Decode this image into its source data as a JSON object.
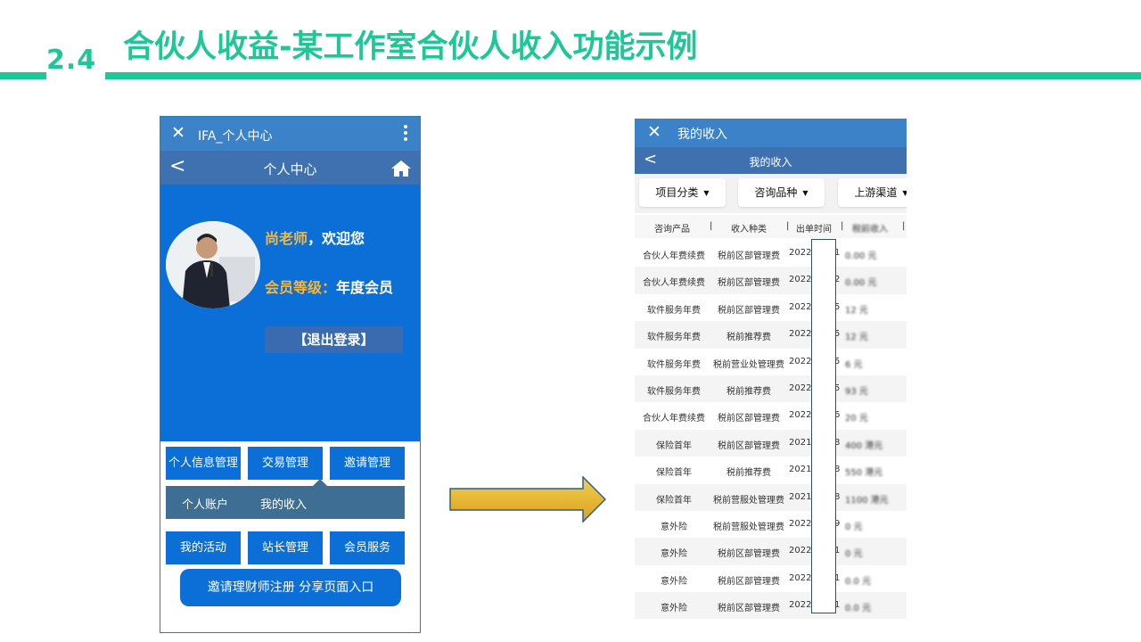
{
  "slide": {
    "section_number": "2.4",
    "title": "合伙人收益-某工作室合伙人收入功能示例",
    "accent_color": "#1ec896"
  },
  "phone_profile": {
    "app_bar": {
      "close_icon": "close-icon",
      "title": "IFA_个人中心",
      "menu_icon": "more-vertical-icon"
    },
    "nav_bar": {
      "back_icon": "chevron-left-icon",
      "title": "个人中心",
      "home_icon": "home-icon"
    },
    "hero": {
      "avatar_icon": "avatar",
      "name": "尚老师",
      "greeting": "，欢迎您",
      "level_label": "会员等级：",
      "level_value": "年度会员",
      "logout_label": "【退出登录】"
    },
    "menu_row1": [
      "个人信息管理",
      "交易管理",
      "邀请管理"
    ],
    "submenu": [
      "个人账户",
      "我的收入"
    ],
    "menu_row2": [
      "我的活动",
      "站长管理",
      "会员服务"
    ],
    "invite_button": "邀请理财师注册 分享页面入口",
    "colors": {
      "header": "#3b82c9",
      "nav": "#3f71b0",
      "primary": "#0b6fd7",
      "gold": "#f6b73c",
      "submenu": "#3e6e94"
    }
  },
  "phone_income": {
    "app_bar": {
      "close_icon": "close-icon",
      "title": "我的收入"
    },
    "nav_bar": {
      "back_icon": "chevron-left-icon",
      "title": "我的收入"
    },
    "filters": [
      "项目分类",
      "咨询品种",
      "上游渠道"
    ],
    "columns": [
      "咨询产品",
      "收入种类",
      "出单时间",
      "税前收入"
    ],
    "rows": [
      {
        "product": "合伙人年费续费",
        "kind": "税前区部管理费",
        "date": "2022",
        "day": "1",
        "amount": "0.00 元"
      },
      {
        "product": "合伙人年费续费",
        "kind": "税前区部管理费",
        "date": "2022",
        "day": "2",
        "amount": "0.00 元"
      },
      {
        "product": "软件服务年费",
        "kind": "税前区部管理费",
        "date": "2022",
        "day": "5",
        "amount": "12 元"
      },
      {
        "product": "软件服务年费",
        "kind": "税前推荐费",
        "date": "2022",
        "day": "5",
        "amount": "12 元"
      },
      {
        "product": "软件服务年费",
        "kind": "税前营业处管理费",
        "date": "2022",
        "day": "5",
        "amount": "6 元"
      },
      {
        "product": "软件服务年费",
        "kind": "税前推荐费",
        "date": "2022",
        "day": "5",
        "amount": "93 元"
      },
      {
        "product": "合伙人年费续费",
        "kind": "税前区部管理费",
        "date": "2022",
        "day": "6",
        "amount": "20 元"
      },
      {
        "product": "保险首年",
        "kind": "税前区部管理费",
        "date": "2021",
        "day": "8",
        "amount": "400 港元"
      },
      {
        "product": "保险首年",
        "kind": "税前推荐费",
        "date": "2021",
        "day": "8",
        "amount": "550 港元"
      },
      {
        "product": "保险首年",
        "kind": "税前营服处管理费",
        "date": "2021",
        "day": "8",
        "amount": "1100 港元"
      },
      {
        "product": "意外险",
        "kind": "税前营服处管理费",
        "date": "2022",
        "day": "9",
        "amount": "0 元"
      },
      {
        "product": "意外险",
        "kind": "税前区部管理费",
        "date": "2022",
        "day": "1",
        "amount": "0 元"
      },
      {
        "product": "意外险",
        "kind": "税前区部管理费",
        "date": "2022",
        "day": "1",
        "amount": "0.0 元"
      },
      {
        "product": "意外险",
        "kind": "税前区部管理费",
        "date": "2022",
        "day": "1",
        "amount": "0.0 元"
      }
    ]
  },
  "arrow": {
    "icon": "right-arrow-icon",
    "fill": "#e8b52e",
    "stroke": "#2e5f88"
  }
}
